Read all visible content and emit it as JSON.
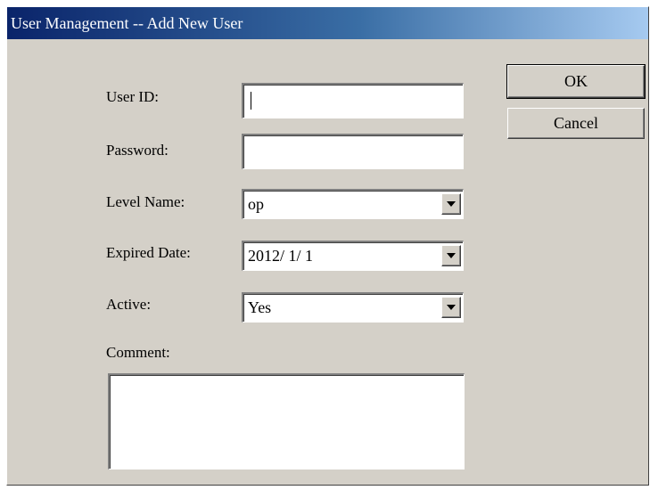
{
  "window": {
    "title": "User Management -- Add New User"
  },
  "form": {
    "user_id": {
      "label": "User ID:",
      "value": ""
    },
    "password": {
      "label": "Password:",
      "value": ""
    },
    "level_name": {
      "label": "Level Name:",
      "value": "op"
    },
    "expired_date": {
      "label": "Expired Date:",
      "value": "2012/ 1/ 1"
    },
    "active": {
      "label": "Active:",
      "value": "Yes"
    },
    "comment": {
      "label": "Comment:",
      "value": ""
    }
  },
  "buttons": {
    "ok_label": "OK",
    "cancel_label": "Cancel"
  },
  "icons": {
    "dropdown": "chevron-down-icon"
  },
  "colors": {
    "titlebar_start": "#0a246a",
    "titlebar_end": "#a6caf0",
    "dialog_face": "#d4d0c8"
  }
}
